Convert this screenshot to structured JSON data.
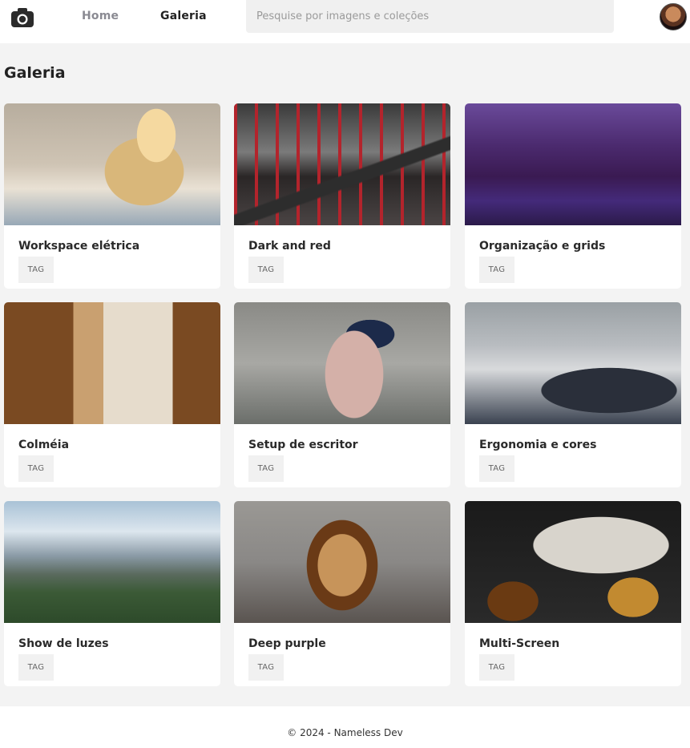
{
  "header": {
    "logo_icon": "camera-icon",
    "nav": {
      "home": "Home",
      "gallery": "Galeria"
    },
    "search": {
      "placeholder": "Pesquise por imagens e coleções",
      "value": ""
    },
    "avatar_icon": "user-avatar"
  },
  "page": {
    "title": "Galeria"
  },
  "gallery": {
    "cards": [
      {
        "title": "Workspace elétrica",
        "tag": "TAG"
      },
      {
        "title": "Dark and red",
        "tag": "TAG"
      },
      {
        "title": "Organização e grids",
        "tag": "TAG"
      },
      {
        "title": "Colméia",
        "tag": "TAG"
      },
      {
        "title": "Setup de escritor",
        "tag": "TAG"
      },
      {
        "title": "Ergonomia e cores",
        "tag": "TAG"
      },
      {
        "title": "Show de luzes",
        "tag": "TAG"
      },
      {
        "title": "Deep purple",
        "tag": "TAG"
      },
      {
        "title": "Multi-Screen",
        "tag": "TAG"
      }
    ]
  },
  "footer": {
    "text": "© 2024 - Nameless Dev"
  }
}
